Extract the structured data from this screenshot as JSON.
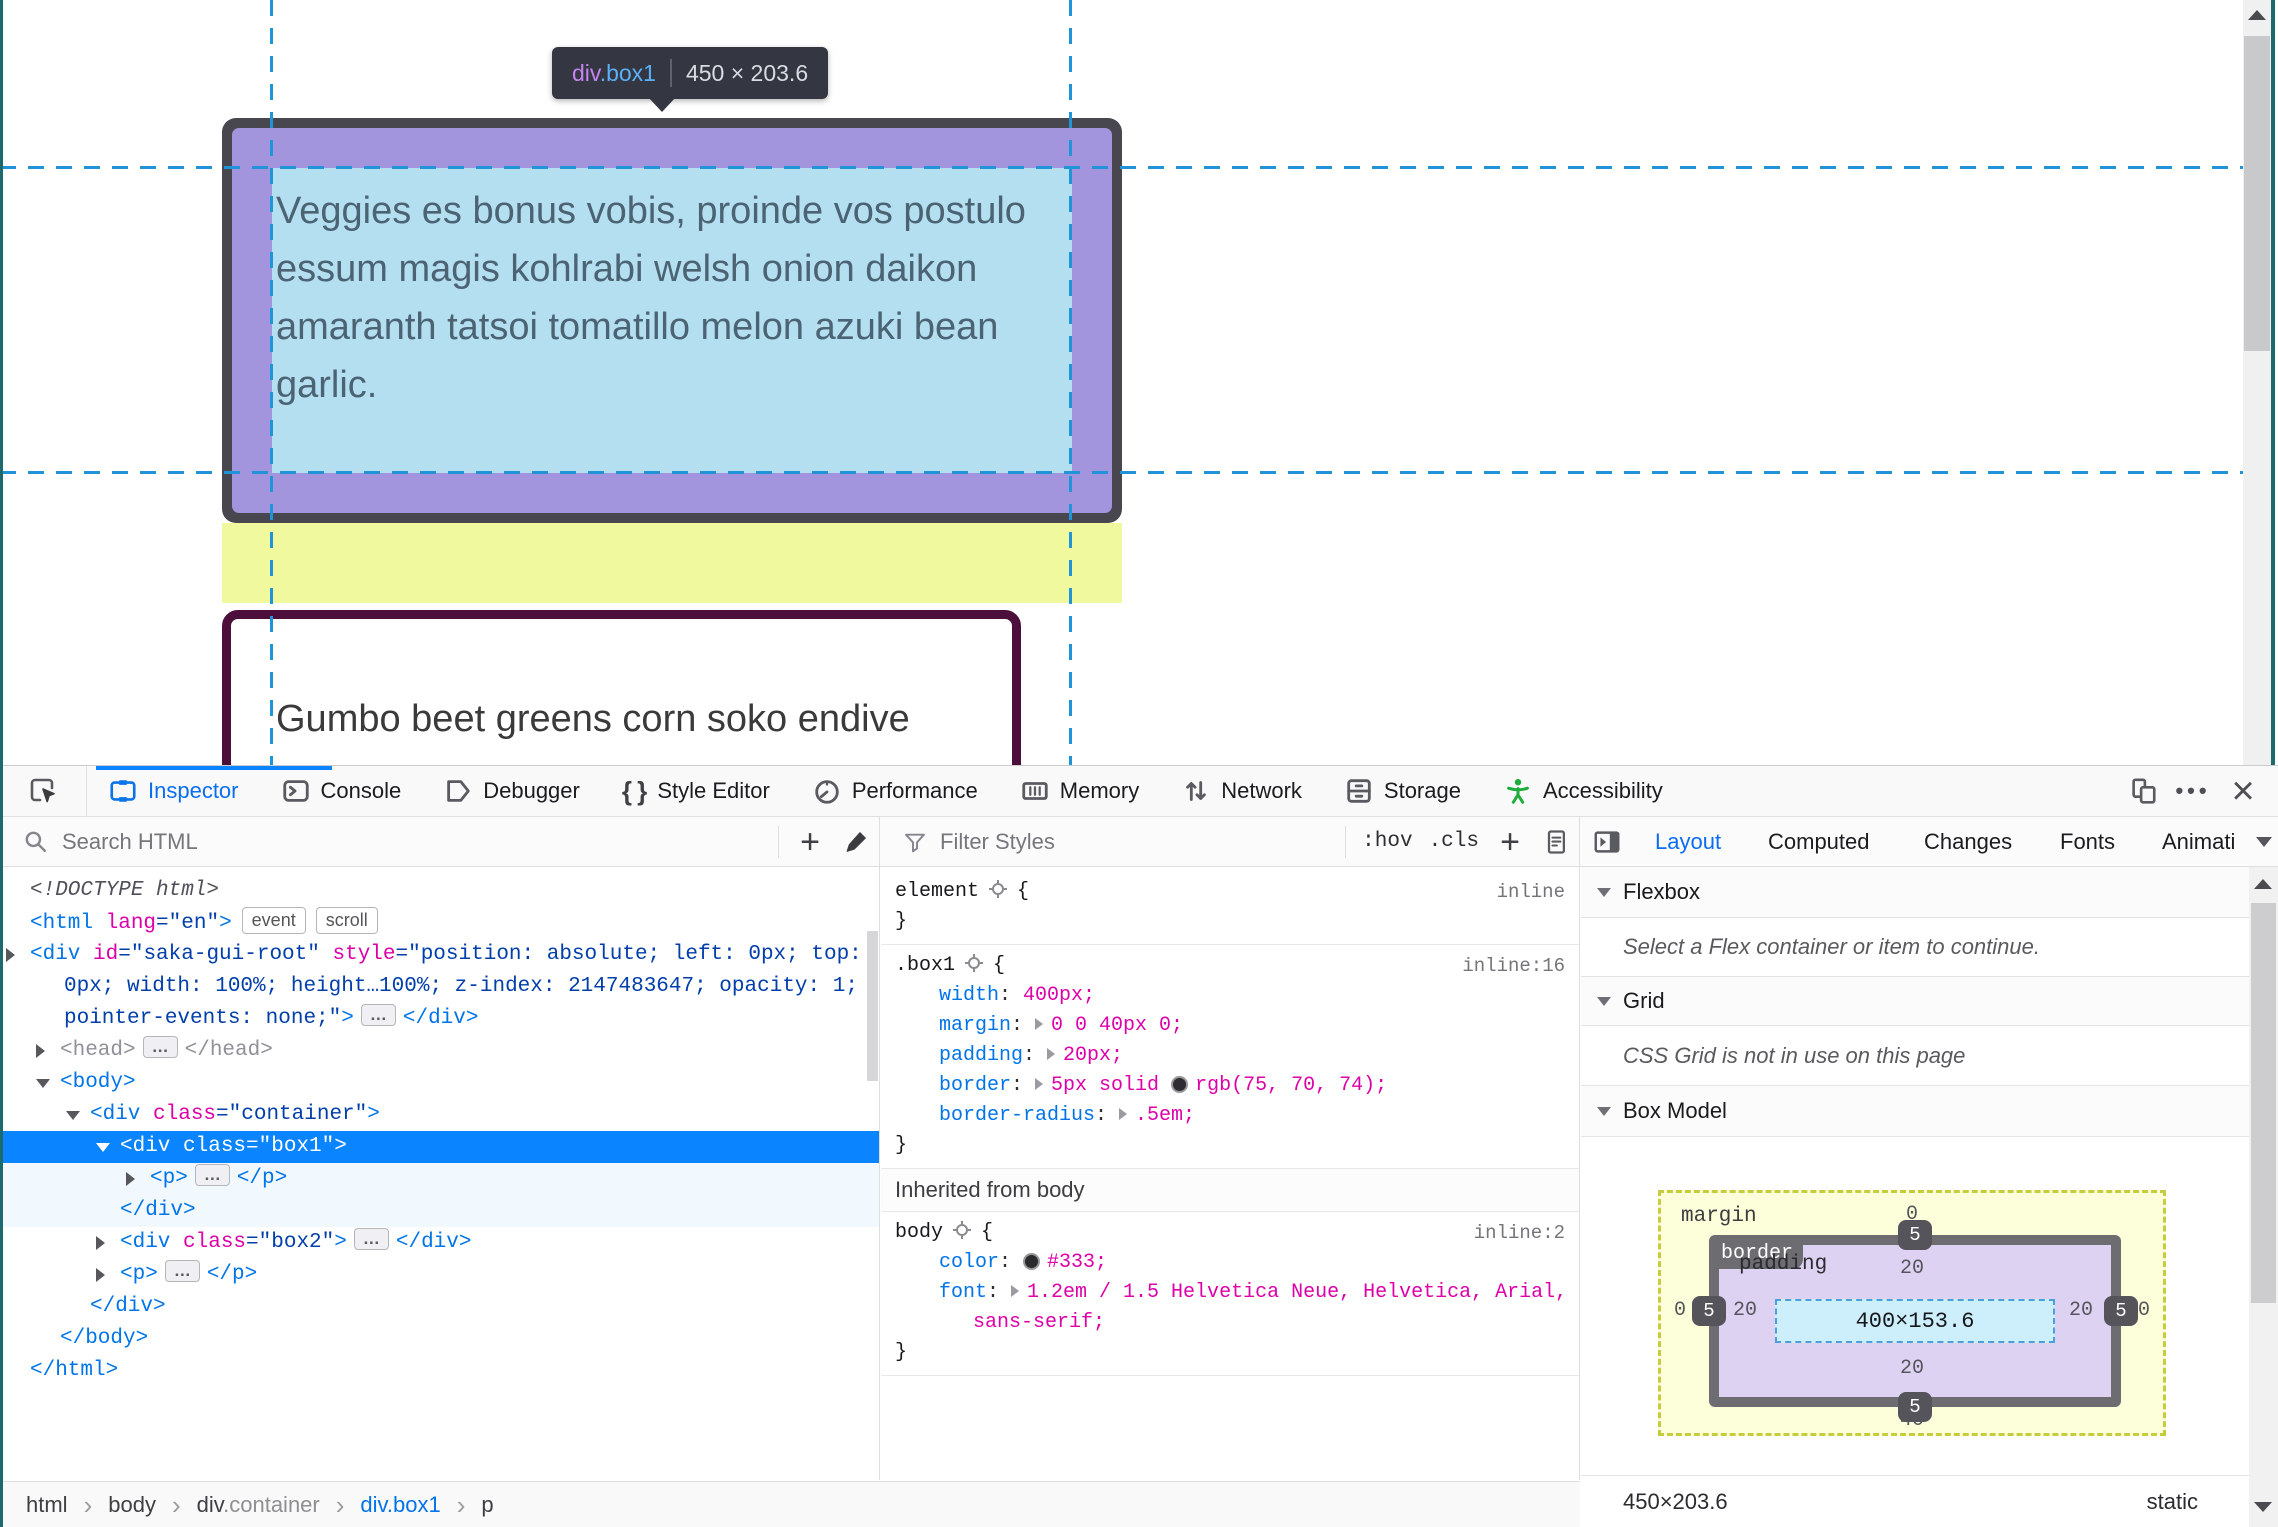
{
  "page": {
    "tooltip": {
      "tag": "div",
      "cls": ".box1",
      "dims": "450 × 203.6"
    },
    "box1_lines": [
      "Veggies es bonus vobis, proinde vos postulo",
      "essum magis kohlrabi welsh onion daikon",
      "amaranth tatsoi tomatillo melon azuki bean",
      "garlic."
    ],
    "box2_text": "Gumbo beet greens corn soko endive"
  },
  "toolbar": {
    "tabs": [
      {
        "label": "Inspector"
      },
      {
        "label": "Console"
      },
      {
        "label": "Debugger"
      },
      {
        "label": "Style Editor"
      },
      {
        "label": "Performance"
      },
      {
        "label": "Memory"
      },
      {
        "label": "Network"
      },
      {
        "label": "Storage"
      },
      {
        "label": "Accessibility"
      }
    ]
  },
  "search": {
    "placeholder": "Search HTML"
  },
  "filter": {
    "placeholder": "Filter Styles",
    "pseudo": ":hov",
    "cls": ".cls"
  },
  "sidebar_tabs": {
    "items": [
      "Layout",
      "Computed",
      "Changes",
      "Fonts",
      "Animati"
    ]
  },
  "markup": {
    "rows": [
      {
        "indent": 0,
        "segs": [
          [
            "<!DOCTYPE html>",
            "doc"
          ]
        ]
      },
      {
        "indent": 0,
        "segs": [
          [
            "<html ",
            "tag"
          ],
          [
            "lang",
            "attr"
          ],
          [
            "=\"en\"",
            "val"
          ],
          [
            ">",
            "tag"
          ],
          [
            "event",
            "badge"
          ],
          [
            "scroll",
            "badge"
          ]
        ]
      },
      {
        "indent": 0,
        "arrow": "r",
        "segs": [
          [
            "<div ",
            "tag"
          ],
          [
            "id",
            "attr"
          ],
          [
            "=\"saka-gui-root\" ",
            "val"
          ],
          [
            "style",
            "attr"
          ],
          [
            "=\"position: absolute; left: 0px; top:",
            "val"
          ]
        ]
      },
      {
        "indent": 0,
        "wrap": true,
        "segs": [
          [
            "0px; width: 100%; height…100%; z-index: 2147483647; opacity: 1;",
            "val"
          ]
        ]
      },
      {
        "indent": 0,
        "wrap": true,
        "segs": [
          [
            "pointer-events: none;\"",
            "val"
          ],
          [
            ">",
            "tag"
          ],
          [
            "…",
            "ell"
          ],
          [
            "</div>",
            "tag"
          ]
        ]
      },
      {
        "indent": 1,
        "arrow": "r",
        "segs": [
          [
            "<head>",
            "dim"
          ],
          [
            "…",
            "ell"
          ],
          [
            "</head>",
            "dim"
          ]
        ]
      },
      {
        "indent": 1,
        "arrow": "d",
        "segs": [
          [
            "<body>",
            "tag"
          ]
        ]
      },
      {
        "indent": 2,
        "arrow": "d",
        "segs": [
          [
            "<div ",
            "tag"
          ],
          [
            "class",
            "attr"
          ],
          [
            "=\"container\"",
            "val"
          ],
          [
            ">",
            "tag"
          ]
        ]
      },
      {
        "indent": 3,
        "arrow": "d",
        "bg": "sel",
        "segs": [
          [
            "<div ",
            "tag"
          ],
          [
            "class",
            "attr"
          ],
          [
            "=\"box1\"",
            "val"
          ],
          [
            ">",
            "tag"
          ]
        ]
      },
      {
        "indent": 4,
        "arrow": "r",
        "bg": "kid",
        "segs": [
          [
            "<p>",
            "tag"
          ],
          [
            "…",
            "ell"
          ],
          [
            "</p>",
            "tag"
          ]
        ]
      },
      {
        "indent": 3,
        "bg": "kid",
        "segs": [
          [
            "</div>",
            "tag"
          ]
        ]
      },
      {
        "indent": 3,
        "arrow": "r",
        "segs": [
          [
            "<div ",
            "tag"
          ],
          [
            "class",
            "attr"
          ],
          [
            "=\"box2\"",
            "val"
          ],
          [
            ">",
            "tag"
          ],
          [
            "…",
            "ell"
          ],
          [
            "</div>",
            "tag"
          ]
        ]
      },
      {
        "indent": 3,
        "arrow": "r",
        "segs": [
          [
            "<p>",
            "tag"
          ],
          [
            "…",
            "ell"
          ],
          [
            "</p>",
            "tag"
          ]
        ]
      },
      {
        "indent": 2,
        "segs": [
          [
            "</div>",
            "tag"
          ]
        ]
      },
      {
        "indent": 1,
        "segs": [
          [
            "</body>",
            "tag"
          ]
        ]
      },
      {
        "indent": 0,
        "segs": [
          [
            "</html>",
            "tag"
          ]
        ]
      }
    ]
  },
  "rules": {
    "sections": [
      {
        "type": "rule",
        "selector": "element",
        "loc": "inline",
        "props": []
      },
      {
        "type": "rule",
        "selector": ".box1",
        "loc": "inline:16",
        "props": [
          {
            "name": "width",
            "segs": [
              [
                "400px;",
                "val"
              ]
            ]
          },
          {
            "name": "margin",
            "tri": true,
            "segs": [
              [
                "0 0 40px 0;",
                "val"
              ]
            ]
          },
          {
            "name": "padding",
            "tri": true,
            "segs": [
              [
                "20px;",
                "val"
              ]
            ]
          },
          {
            "name": "border",
            "tri": true,
            "segs": [
              [
                "5px solid ",
                "val"
              ],
              [
                "#2f2d31",
                "swatch"
              ],
              [
                "rgb(75, 70, 74);",
                "val"
              ]
            ]
          },
          {
            "name": "border-radius",
            "tri": true,
            "segs": [
              [
                ".5em;",
                "val"
              ]
            ]
          }
        ]
      },
      {
        "type": "header",
        "label": "Inherited from body"
      },
      {
        "type": "rule",
        "selector": "body",
        "loc": "inline:2",
        "props": [
          {
            "name": "color",
            "segs": [
              [
                "#2b2b2b",
                "swatch"
              ],
              [
                "#333;",
                "val"
              ]
            ]
          },
          {
            "name": "font",
            "tri": true,
            "segs": [
              [
                "1.2em / 1.5 Helvetica Neue, Helvetica, Arial,",
                "val"
              ]
            ],
            "wrap": "sans-serif;"
          }
        ]
      }
    ]
  },
  "layout_panel": {
    "flexbox": {
      "title": "Flexbox",
      "message": "Select a Flex container or item to continue."
    },
    "grid": {
      "title": "Grid",
      "message": "CSS Grid is not in use on this page"
    },
    "box_model": {
      "title": "Box Model",
      "labels": {
        "margin": "margin",
        "border": "border",
        "padding": "padding"
      },
      "content": "400×153.6",
      "values": {
        "margin_top": "0",
        "margin_right": "0",
        "margin_bottom": "40",
        "margin_left": "0",
        "border_top": "5",
        "border_right": "5",
        "border_bottom": "5",
        "border_left": "5",
        "padding_top": "20",
        "padding_right": "20",
        "padding_bottom": "20",
        "padding_left": "20"
      },
      "footer": {
        "size": "450×203.6",
        "position": "static"
      }
    }
  },
  "breadcrumbs": {
    "items": [
      {
        "text": "html",
        "style": ""
      },
      {
        "text": "body",
        "style": ""
      },
      {
        "text": "div",
        "suffix": ".container",
        "style": ""
      },
      {
        "text": "div.box1",
        "style": "selected"
      },
      {
        "text": "p",
        "style": ""
      }
    ]
  }
}
